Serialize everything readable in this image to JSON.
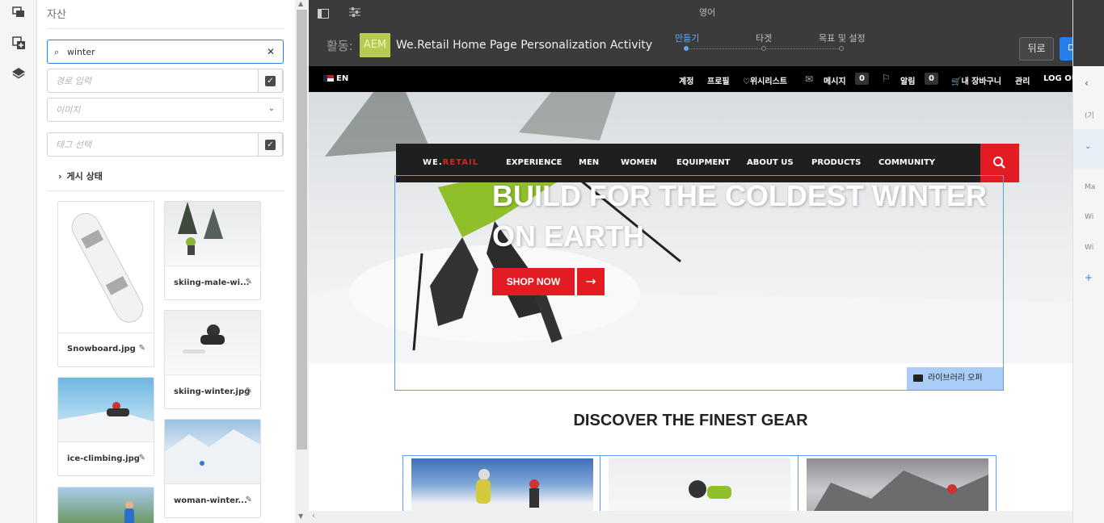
{
  "rail": {
    "icons": [
      "assets-icon",
      "add-component-icon",
      "layers-icon"
    ]
  },
  "panel": {
    "title": "자산",
    "search_value": "winter",
    "path_placeholder": "경로 입력",
    "type_value": "이미지",
    "tag_placeholder": "태그 선택",
    "publish_status": "게시 상태",
    "assets": [
      {
        "name": "Snowboard.jpg"
      },
      {
        "name": "skiing-male-wi..."
      },
      {
        "name": "skiing-winter.jpg"
      },
      {
        "name": "ice-climbing.jpg"
      },
      {
        "name": "woman-winter..."
      }
    ]
  },
  "topbar": {
    "language": "영어",
    "activity_label": "활동:",
    "aem_badge": "AEM",
    "activity_title": "We.Retail Home Page Personalization Activity",
    "steps": [
      "만들기",
      "타겟",
      "목표 및 설정"
    ],
    "active_step": 0,
    "back_label": "뒤로",
    "next_label": "다음"
  },
  "site": {
    "utility": {
      "lang": "EN",
      "account": "계정",
      "profile": "프로필",
      "wishlist": "♡위시리스트",
      "messages": "메시지",
      "messages_count": "0",
      "alerts": "알림",
      "alerts_count": "0",
      "cart": "내 장바구니",
      "admin": "관리",
      "logout": "LOG OU"
    },
    "logo_a": "WE.",
    "logo_b": "RETAIL",
    "nav": [
      "EXPERIENCE",
      "MEN",
      "WOMEN",
      "EQUIPMENT",
      "ABOUT US",
      "PRODUCTS",
      "COMMUNITY"
    ],
    "hero_title_1": "BUILD FOR THE COLDEST WINTER",
    "hero_title_2": "ON EARTH",
    "shop_now": "SHOP NOW",
    "library_offer": "라이브러리 오퍼",
    "discover": "DISCOVER THE FINEST GEAR"
  },
  "right_side": {
    "labels": [
      "(기",
      "Ma",
      "Wi",
      "Wi",
      "+"
    ]
  },
  "colors": {
    "accent": "#2680eb",
    "brand_red": "#e31c23",
    "aem": "#b8c94f"
  }
}
